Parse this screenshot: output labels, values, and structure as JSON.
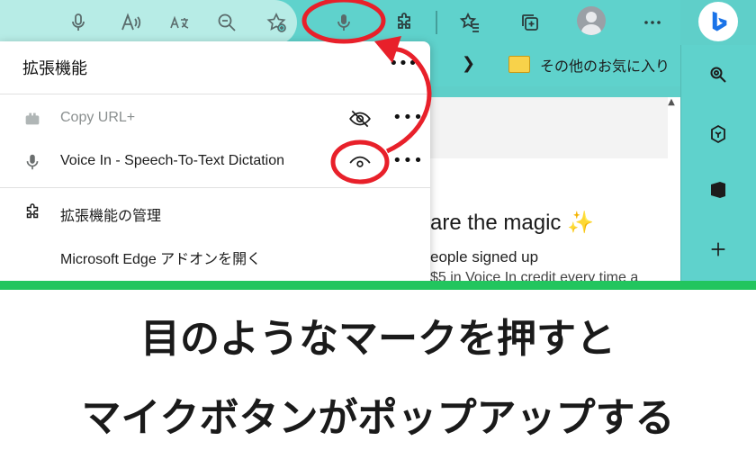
{
  "menu": {
    "title": "拡張機能",
    "more_label": "•••",
    "extensions": [
      {
        "name": "Copy URL+",
        "icon": "copy-url-icon",
        "visibility": "hidden"
      },
      {
        "name": "Voice In - Speech-To-Text Dictation",
        "icon": "microphone-icon",
        "visibility": "shown"
      }
    ],
    "manage_label": "拡張機能の管理",
    "addons_label": "Microsoft Edge アドオンを開く"
  },
  "favorites": {
    "other_label": "その他のお気に入り"
  },
  "page": {
    "headline": "are the magic",
    "line1": "eople signed up",
    "line2": "$5 in Voice In credit every time a"
  },
  "caption": {
    "line1": "目のようなマークを押すと",
    "line2": "マイクボタンがポップアップする"
  },
  "colors": {
    "toolbar": "#5fd2cc",
    "annotation_red": "#e8202a",
    "divider_green": "#22c55e"
  }
}
